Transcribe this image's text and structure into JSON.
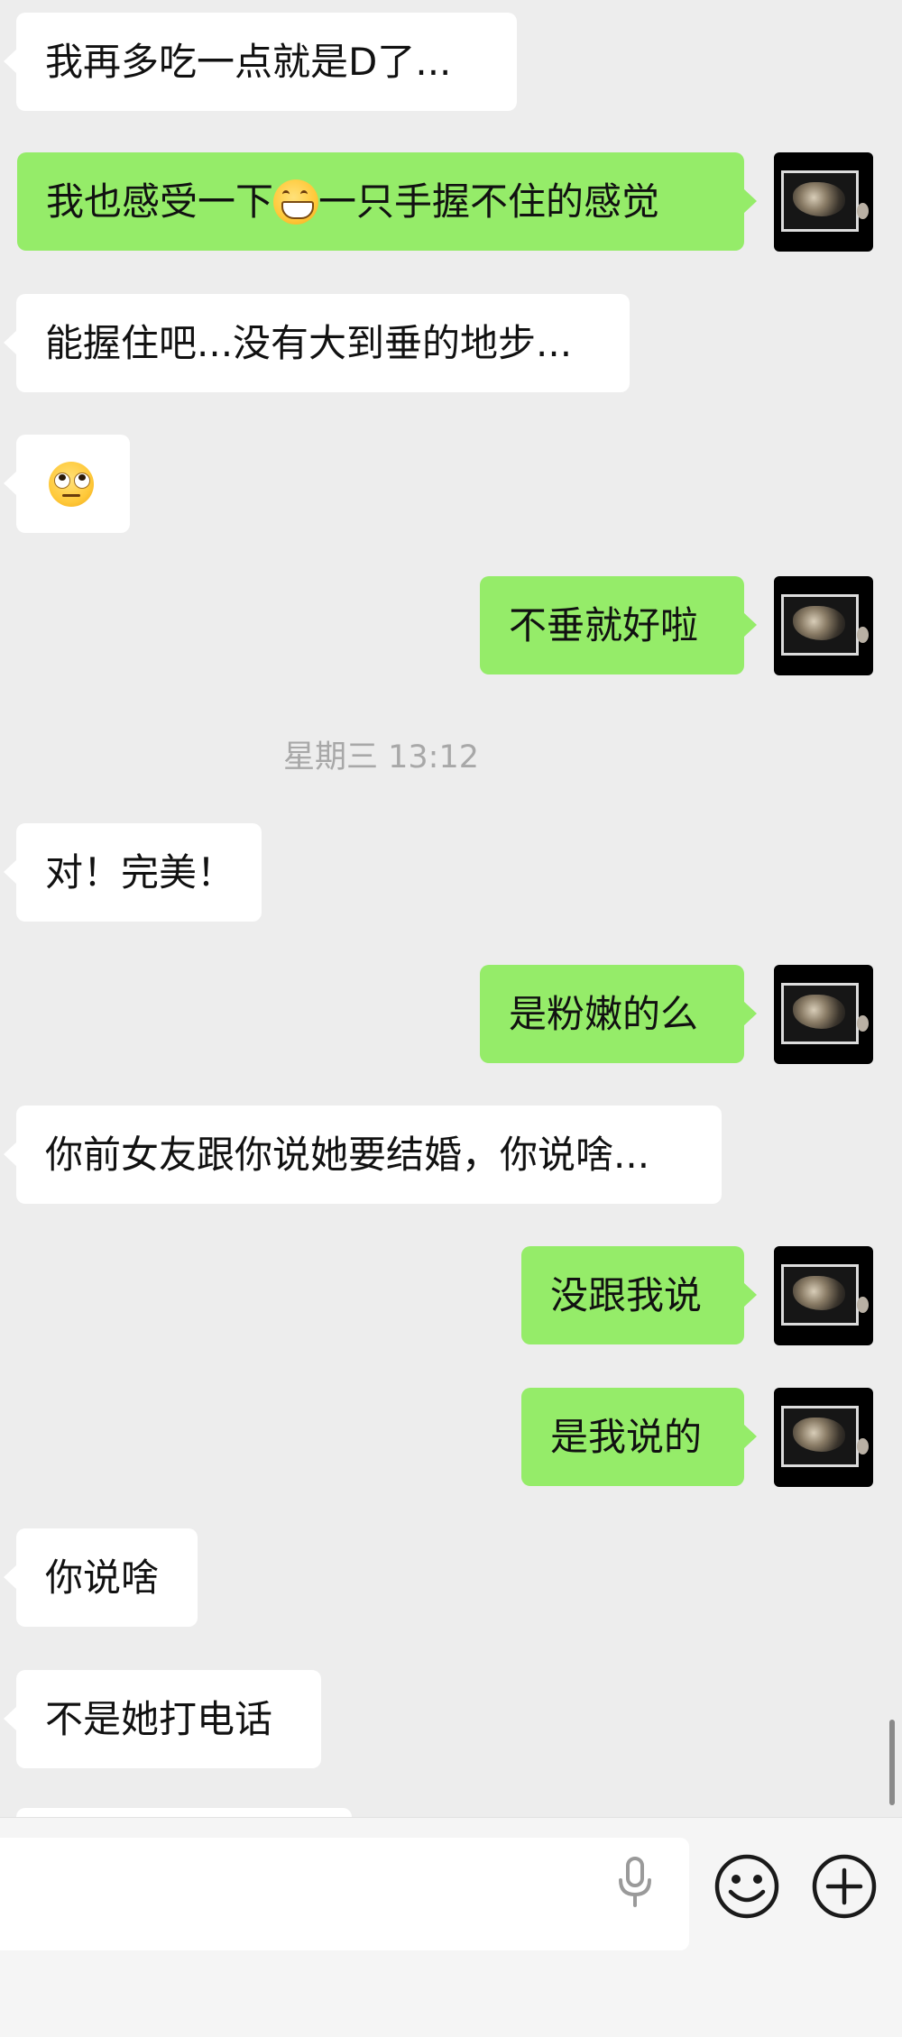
{
  "messages": [
    {
      "side": "left",
      "text": "我再多吃一点就是D了..."
    },
    {
      "side": "right",
      "text_before": "我也感受一下",
      "emoji": "grinning-squinting-face",
      "text_after": "一只手握不住的感觉"
    },
    {
      "side": "left",
      "text": "能握住吧...没有大到垂的地步..."
    },
    {
      "side": "left",
      "emoji": "face-with-rolling-eyes"
    },
    {
      "side": "right",
      "text": "不垂就好啦"
    },
    {
      "timestamp": "星期三 13:12"
    },
    {
      "side": "left",
      "text": "对！完美！"
    },
    {
      "side": "right",
      "text": "是粉嫩的么"
    },
    {
      "side": "left",
      "text": "你前女友跟你说她要结婚，你说啥..."
    },
    {
      "side": "right",
      "text": "没跟我说"
    },
    {
      "side": "right",
      "text": "是我说的"
    },
    {
      "side": "left",
      "text": "你说啥"
    },
    {
      "side": "left",
      "text": "不是她打电话"
    }
  ],
  "input": {
    "value": "",
    "placeholder": ""
  },
  "icons": {
    "voice": "microphone-icon",
    "emoji": "smiley-face-icon",
    "more": "plus-circle-icon"
  },
  "colors": {
    "background": "#ededed",
    "outgoing_bubble": "#95ec69",
    "incoming_bubble": "#ffffff",
    "timestamp_text": "#a8a8a8"
  }
}
